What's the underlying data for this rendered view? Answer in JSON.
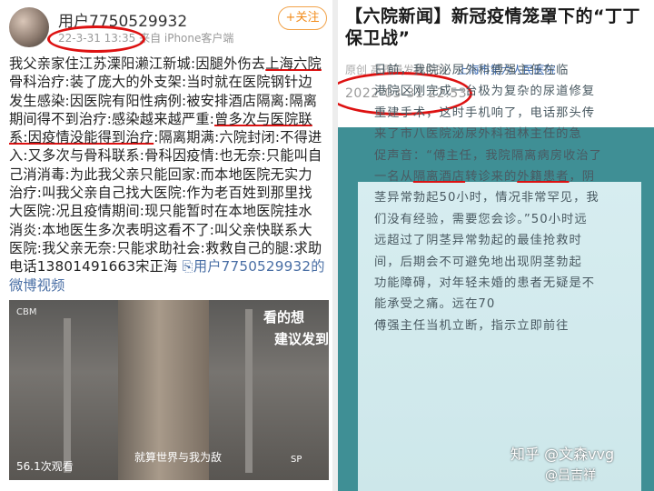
{
  "left_post": {
    "username": "用户7750529932",
    "time": "22-3-31 13:35",
    "device": "来自 iPhone客户端",
    "follow_label": "+关注",
    "lines": [
      "我父亲家住江苏溧阳濑江新城:因腿外伤去上海六院",
      "骨科治疗:装了庞大的外支架:当时就在医院钢针边",
      "发生感染:因医院有阳性病例:被安排酒店隔离:隔离",
      "期间得不到治疗:感染越来越严重:曾多次与医院联",
      "系:因疫情没能得到治疗:隔离期满:六院封闭:不得进",
      "入:又多次与骨科联系:骨科因疫情:也无奈:只能叫自",
      "己消消毒:为此我父亲只能回家:而本地医院无实力",
      "治疗:叫我父亲自己找大医院:作为老百姓到那里找",
      "大医院:况且疫情期间:现只能暂时在本地医院挂水",
      "消炎:本地医生多次表明这看不了:叫父亲快联系大",
      "医院:我父亲无奈:只能求助社会:救救自己的腿:求助",
      "电话13801491663宋正海 "
    ],
    "mention": "用户7750529932的",
    "video_label": "微博视频"
  },
  "video": {
    "brand": "CBM",
    "caption1": "看的想",
    "caption2": "建议发到",
    "tip": "就算世界与我为敌",
    "views": "56.1次观看",
    "corner": "SP"
  },
  "right_article": {
    "title_line1": "【六院新闻】新冠疫情笼罩下的“丁丁",
    "title_line2": "保卫战”",
    "source_prefix": "原创  高质量发展中的",
    "source_org": "上海市第六人民医院",
    "date": "2022-03-31 22:53",
    "lines": [
      "日前，我院泌尿外科傅强主任在临",
      "港院区刚完成一台极为复杂的尿道修复",
      "重建手术，这时手机响了，电话那头传",
      "来了市八医院泌尿外科祖林主任的急",
      "促声音：“傅主任，我院隔离病房收治了",
      "一名从隔离酒店转诊来的外籍患者，阴",
      "茎异常勃起50小时，情况非常罕见，我",
      "们没有经验，需要您会诊。”50小时远",
      "远超过了阴茎异常勃起的最佳抢救时",
      "间，后期会不可避免地出现阴茎勃起",
      "功能障碍，对年轻未婚的患者无疑是不",
      "能承受之痛。远在70",
      "傅强主任当机立断，指示立即前往"
    ],
    "watermark1": "知乎 @文森vvg",
    "watermark2": "@吕吉祥"
  }
}
